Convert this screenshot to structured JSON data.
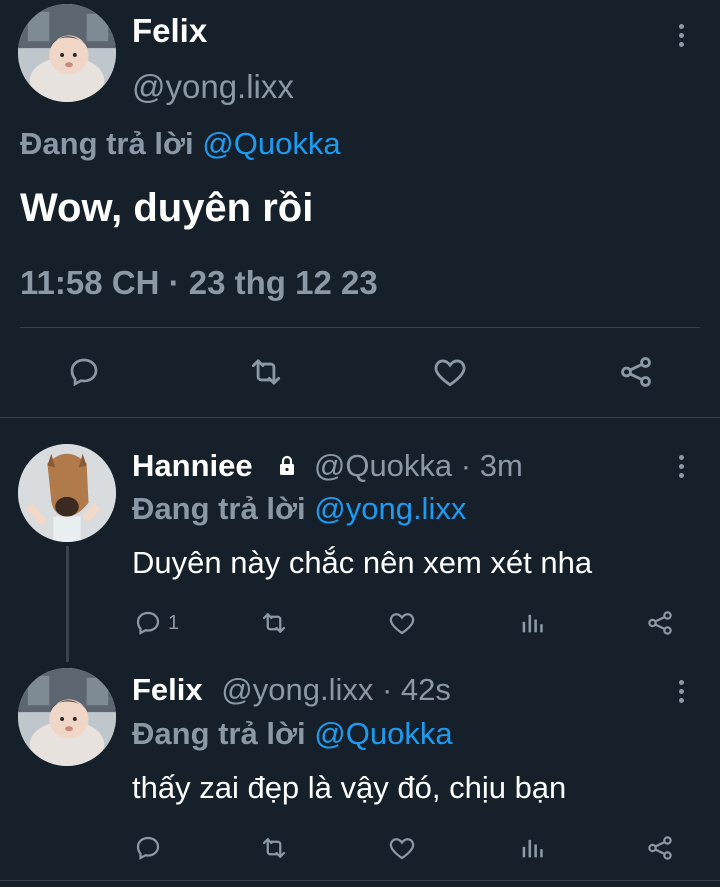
{
  "main_tweet": {
    "display_name": "Felix",
    "handle": "@yong.lixx",
    "replying_prefix": "Đang trả lời",
    "replying_to": "@Quokka",
    "text": "Wow, duyên rồi",
    "timestamp": "11:58 CH · 23 thg 12 23"
  },
  "replies": [
    {
      "display_name": "Hanniee",
      "handle": "@Quokka",
      "time": "· 3m",
      "replying_prefix": "Đang trả lời",
      "replying_to": "@yong.lixx",
      "text": "Duyên này chắc nên xem xét nha",
      "reply_count": "1"
    },
    {
      "display_name": "Felix",
      "handle": "@yong.lixx",
      "time": "· 42s",
      "replying_prefix": "Đang trả lời",
      "replying_to": "@Quokka",
      "text": "thấy zai đẹp là vậy đó, chịu bạn"
    }
  ],
  "colors": {
    "background": "#15202b",
    "accent": "#1d9bf0",
    "muted_text": "#8b98a5",
    "divider": "#38444d"
  }
}
